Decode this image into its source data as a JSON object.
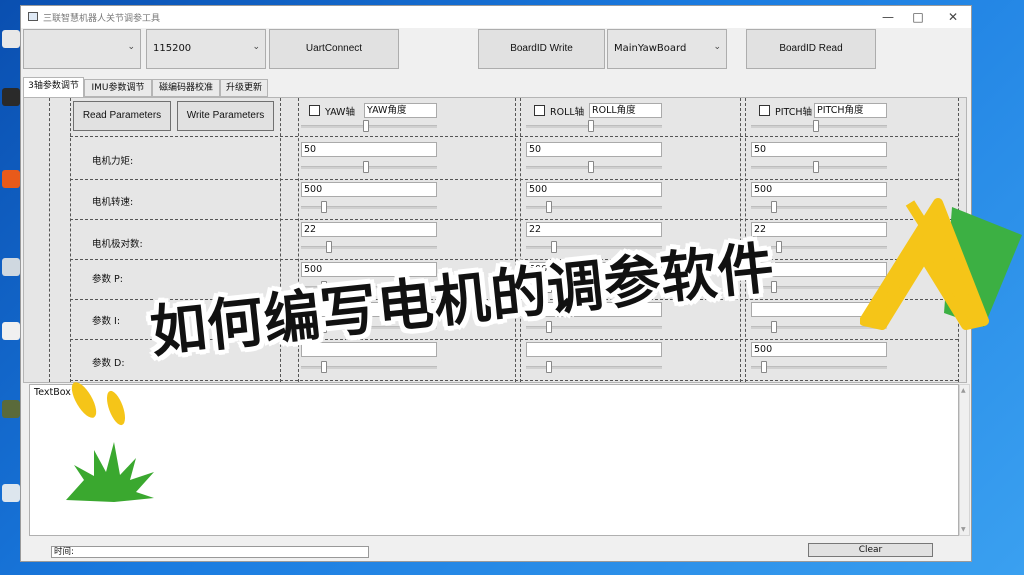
{
  "window": {
    "title": "三联智慧机器人关节调参工具",
    "minimize_glyph": "—",
    "maximize_glyph": "□",
    "close_glyph": "✕"
  },
  "toolbar": {
    "port_combo_value": "",
    "baud_combo_value": "115200",
    "uart_connect_label": "UartConnect",
    "boardid_write_label": "BoardID Write",
    "board_combo_value": "MainYawBoard",
    "boardid_read_label": "BoardID Read",
    "dropdown_glyph": "⌄"
  },
  "tabs": [
    {
      "label": "3轴参数调节",
      "active": true
    },
    {
      "label": "IMU参数调节",
      "active": false
    },
    {
      "label": "磁编码器校准",
      "active": false
    },
    {
      "label": "升级更新",
      "active": false
    }
  ],
  "params": {
    "read_button": "Read Parameters",
    "write_button": "Write Parameters",
    "labels": [
      "电机力矩:",
      "电机转速:",
      "电机极对数:",
      "参数 P:",
      "参数 I:",
      "参数 D:"
    ]
  },
  "axes": [
    {
      "label": "YAW轴",
      "name": "YAW角度",
      "checked": false,
      "values": [
        "50",
        "500",
        "22",
        "500",
        "",
        ""
      ]
    },
    {
      "label": "ROLL轴",
      "name": "ROLL角度",
      "checked": false,
      "values": [
        "50",
        "500",
        "22",
        "500",
        "",
        ""
      ]
    },
    {
      "label": "PITCH轴",
      "name": "PITCH角度",
      "checked": false,
      "values": [
        "50",
        "500",
        "22",
        "500",
        "",
        "500"
      ]
    }
  ],
  "textbox": {
    "label": "TextBox"
  },
  "status": {
    "time_label": "时间:",
    "clear_label": "Clear"
  },
  "overlay": {
    "title": "如何编写电机的调参软件"
  },
  "colors": {
    "desktop_blue": "#1a7be0",
    "logo_yellow": "#f5c518",
    "logo_green": "#3cb043",
    "grass_green": "#3aa82f"
  }
}
